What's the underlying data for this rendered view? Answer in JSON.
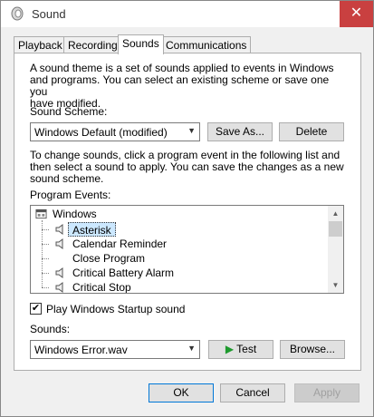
{
  "window": {
    "title": "Sound",
    "close_symbol": "✕",
    "icon": "speaker-app-icon"
  },
  "tabs": [
    {
      "label": "Playback"
    },
    {
      "label": "Recording"
    },
    {
      "label": "Sounds",
      "active": true
    },
    {
      "label": "Communications"
    }
  ],
  "sounds_tab": {
    "intro_line1": "A sound theme is a set of sounds applied to events in Windows",
    "intro_line2": "and programs.  You can select an existing scheme or save one you",
    "intro_line3": "have modified.",
    "scheme_label": "Sound Scheme:",
    "scheme_value": "Windows Default (modified)",
    "save_as_label": "Save As...",
    "delete_label": "Delete",
    "instruct_line1": "To change sounds, click a program event in the following list and",
    "instruct_line2": "then select a sound to apply.  You can save the changes as a new",
    "instruct_line3": "sound scheme.",
    "events_label": "Program Events:",
    "events": {
      "root": "Windows",
      "items": [
        {
          "label": "Asterisk",
          "has_sound": true,
          "selected": true
        },
        {
          "label": "Calendar Reminder",
          "has_sound": true
        },
        {
          "label": "Close Program",
          "has_sound": false
        },
        {
          "label": "Critical Battery Alarm",
          "has_sound": true
        },
        {
          "label": "Critical Stop",
          "has_sound": true
        }
      ]
    },
    "startup_label": "Play Windows Startup sound",
    "startup_checked": true,
    "check_symbol": "✔",
    "sounds_label": "Sounds:",
    "sound_value": "Windows Error.wav",
    "test_label": "Test",
    "test_icon_symbol": "▶",
    "browse_label": "Browse...",
    "dropdown_symbol": "▼",
    "scroll_up_symbol": "▲",
    "scroll_down_symbol": "▼"
  },
  "footer": {
    "ok_label": "OK",
    "cancel_label": "Cancel",
    "apply_label": "Apply"
  },
  "colors": {
    "close_button": "#c94040",
    "play_icon": "#1e9a2e",
    "selection": "#cce8ff",
    "focus_border": "#0078d7"
  }
}
